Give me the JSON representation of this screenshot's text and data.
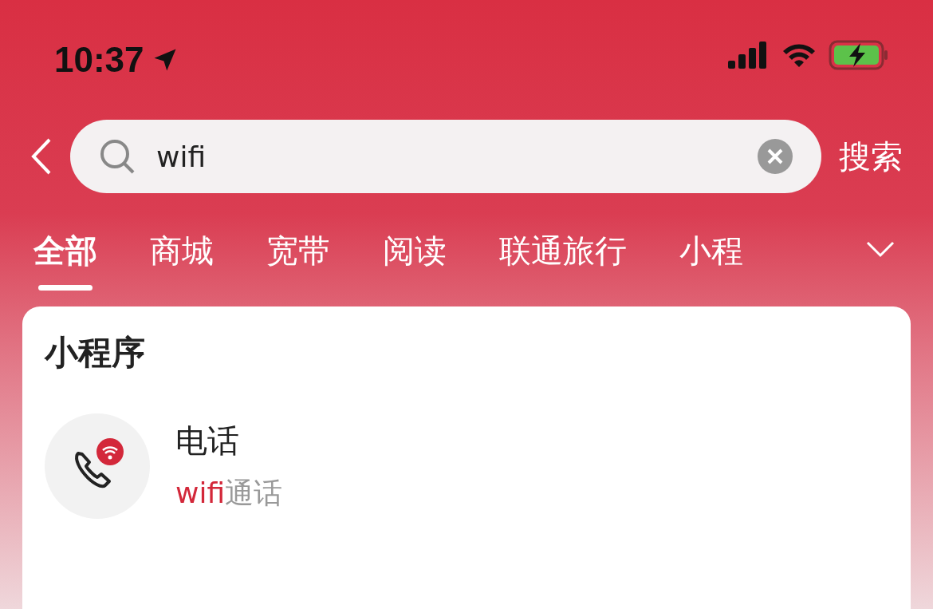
{
  "status_bar": {
    "time": "10:37"
  },
  "search": {
    "value": "wifi",
    "button": "搜索"
  },
  "tabs": [
    {
      "label": "全部",
      "selected": true
    },
    {
      "label": "商城",
      "selected": false
    },
    {
      "label": "宽带",
      "selected": false
    },
    {
      "label": "阅读",
      "selected": false
    },
    {
      "label": "联通旅行",
      "selected": false
    },
    {
      "label": "小程",
      "selected": false
    }
  ],
  "section": {
    "title": "小程序",
    "items": [
      {
        "title": "电话",
        "subtitle": {
          "match": "wifi",
          "rest": "通话"
        }
      }
    ]
  }
}
